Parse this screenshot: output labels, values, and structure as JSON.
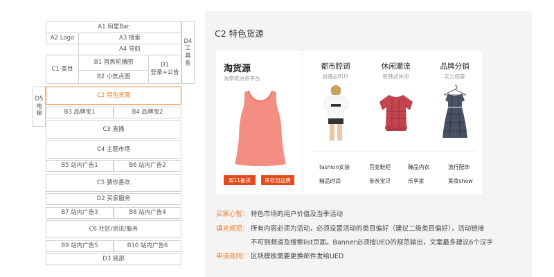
{
  "wireframe": {
    "a1": "A1 阿里Bar",
    "a2": "A2 Logo",
    "a3": "A3 搜索",
    "a4": "A4 导航",
    "c1": "C1 类目",
    "b1": "B1 首焦轮播图",
    "b2": "B2 小焦点图",
    "d1_line1": "D1",
    "d1_line2": "登录+公告",
    "d4_line1": "D4",
    "d4_line2": "工",
    "d4_line3": "具",
    "d4_line4": "条",
    "d5_line1": "D5",
    "d5_line2": "电",
    "d5_line3": "梯",
    "c2": "C2 特色货源",
    "b3": "B3 品牌宝1",
    "b4": "B4 品牌宝2",
    "c3": "C3 直播",
    "c4": "C4 主题市场",
    "b5": "B5 站内广告1",
    "b6": "B6 站内广告2",
    "c5": "C5 猜你喜欢",
    "d2": "D2 买家服务",
    "b7": "B7 站内广告3",
    "b8": "B8 站内广告4",
    "c6": "C6 社区/资讯/服务",
    "b9": "B9 站内广告5",
    "b10": "B10 站内广告6",
    "d3": "D3 底部"
  },
  "panel": {
    "title": "C2 特色货源",
    "featured": {
      "title": "淘货源",
      "subtitle": "淘掌柜进货平台",
      "tag1": "双11备货",
      "tag2": "库存包运费",
      "image_icon": "pink-tank-top"
    },
    "categories": [
      {
        "title": "都市腔调",
        "subtitle": "扮靓必BUY",
        "image_icon": "model-white-tee"
      },
      {
        "title": "休闲潮流",
        "subtitle": "新韩式休闲",
        "image_icon": "red-plaid-blouse"
      },
      {
        "title": "品牌分销",
        "subtitle": "实力招募",
        "image_icon": "plaid-dress-on-hanger"
      }
    ],
    "links": [
      "fashion女装",
      "百变鞋柜",
      "臻品内衣",
      "流行配饰",
      "精品时尚",
      "亲亲宝贝",
      "乐享家",
      "美妆show"
    ],
    "rules": [
      {
        "label": "买家心智：",
        "lines": [
          "特色市场的用户价值及当季活动"
        ]
      },
      {
        "label": "填充规范：",
        "lines": [
          "所有内容必须为活动，必须设置活动的类目偏好（建议二级类目偏好），活动链接",
          "不可到频道及搜索list页面。Banner必须按UED的规范输出，文案最多建议6个汉字"
        ]
      },
      {
        "label": "申请规则：",
        "lines": [
          "区块模板需要更换邮件发给UED"
        ]
      }
    ],
    "accent_color": "#f07620",
    "tag_color": "#e24c1d"
  }
}
